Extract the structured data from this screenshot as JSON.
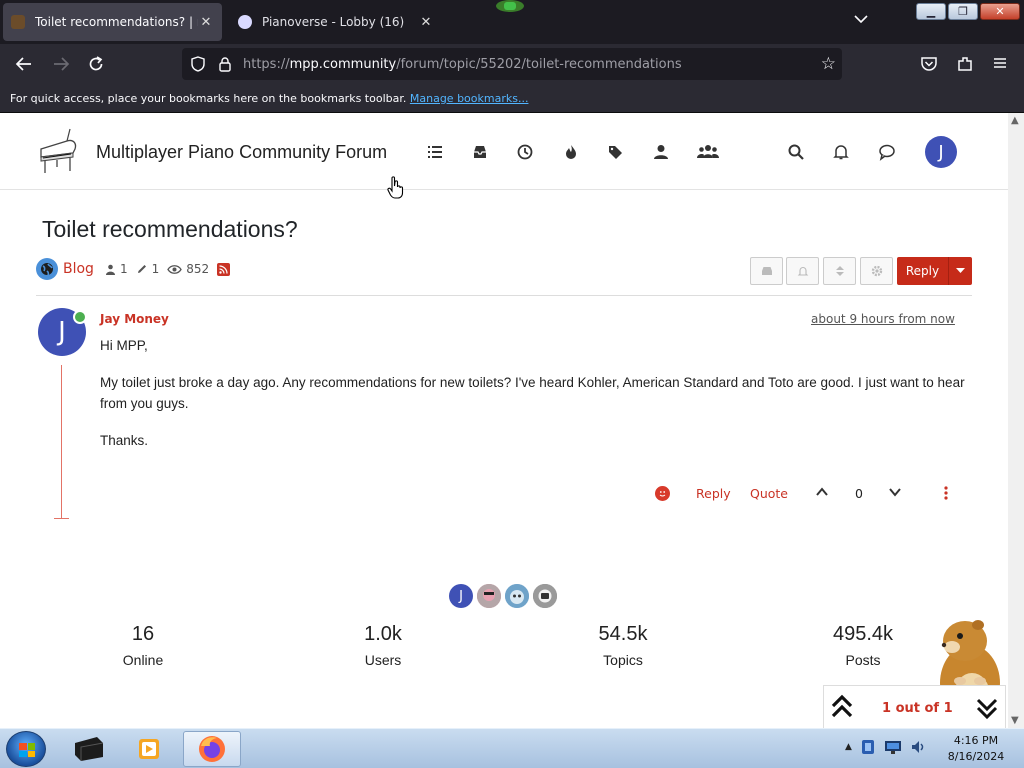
{
  "browser": {
    "tabs": [
      {
        "title": "Toilet recommendations? | mpp",
        "active": true,
        "favicon_color": "#6b4c2a"
      },
      {
        "title": "Pianoverse - Lobby (16)",
        "active": false,
        "favicon_color": "#d9d9ff"
      }
    ],
    "url": {
      "prefix": "https://",
      "host": "mpp.community",
      "path": "/forum/topic/55202/toilet-recommendations"
    },
    "bookmarks_message": "For quick access, place your bookmarks here on the bookmarks toolbar.",
    "bookmarks_link": "Manage bookmarks..."
  },
  "forum": {
    "brand": "Multiplayer Piano Community Forum",
    "user_initial": "J",
    "nav_icons": [
      "categories-icon",
      "unread-icon",
      "recent-icon",
      "popular-icon",
      "tags-icon",
      "user-icon",
      "groups-icon"
    ]
  },
  "topic": {
    "title": "Toilet recommendations?",
    "category": "Blog",
    "posters": "1",
    "posts": "1",
    "views": "852",
    "reply_label": "Reply"
  },
  "post": {
    "author": "Jay Money",
    "author_initial": "J",
    "timestamp": "about 9 hours from now",
    "paragraphs": [
      "Hi MPP,",
      "My toilet just broke a day ago. Any recommendations for new toilets? I've heard Kohler, American Standard and Toto are good. I just want to hear from you guys.",
      "Thanks."
    ],
    "reply_label": "Reply",
    "quote_label": "Quote",
    "votes": "0"
  },
  "stats": [
    {
      "value": "16",
      "label": "Online"
    },
    {
      "value": "1.0k",
      "label": "Users"
    },
    {
      "value": "54.5k",
      "label": "Topics"
    },
    {
      "value": "495.4k",
      "label": "Posts"
    }
  ],
  "online_users": [
    "J"
  ],
  "pagination": {
    "text": "1 out of 1"
  },
  "taskbar": {
    "time": "4:16 PM",
    "date": "8/16/2024"
  },
  "colors": {
    "accent": "#c93325",
    "avatar": "#3f51b5",
    "online": "#4caf50"
  }
}
